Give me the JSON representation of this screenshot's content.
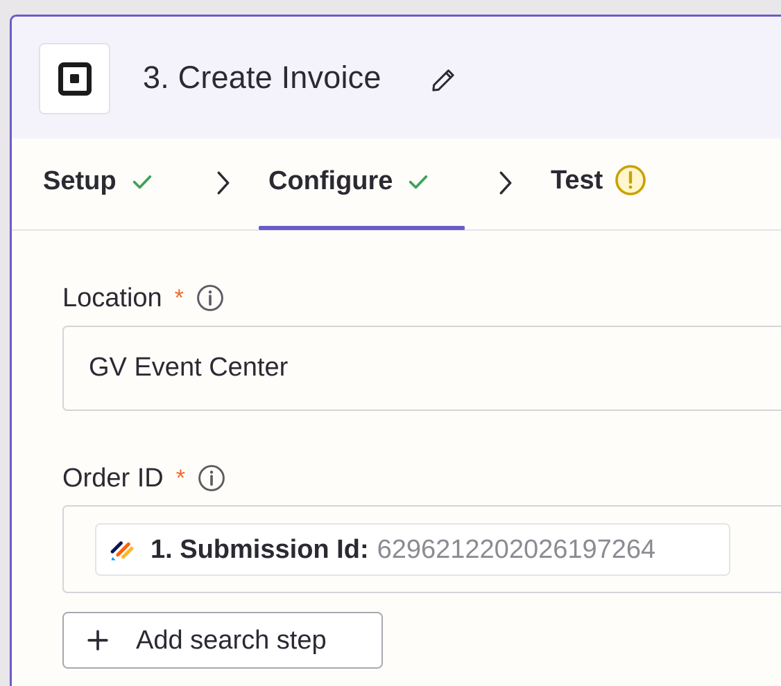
{
  "step": {
    "title": "3. Create Invoice",
    "app_icon": "square-logo-icon",
    "edit_icon": "pencil-icon"
  },
  "tabs": [
    {
      "label": "Setup",
      "status": "complete",
      "status_icon": "check-icon"
    },
    {
      "label": "Configure",
      "status": "complete",
      "status_icon": "check-icon",
      "active": true
    },
    {
      "label": "Test",
      "status": "warning",
      "status_icon": "warning-circle-icon"
    }
  ],
  "fields": {
    "location": {
      "label": "Location",
      "required_marker": "*",
      "value": "GV Event Center"
    },
    "order_id": {
      "label": "Order ID",
      "required_marker": "*",
      "mapped_key": "1. Submission Id:",
      "mapped_value": "6296212202026197264",
      "source_icon": "jotform-icon"
    }
  },
  "actions": {
    "add_search_step": "Add search step"
  },
  "colors": {
    "accent": "#6a5cc8",
    "check": "#3aa35a",
    "warning": "#c9a100",
    "required": "#f06a2b"
  }
}
